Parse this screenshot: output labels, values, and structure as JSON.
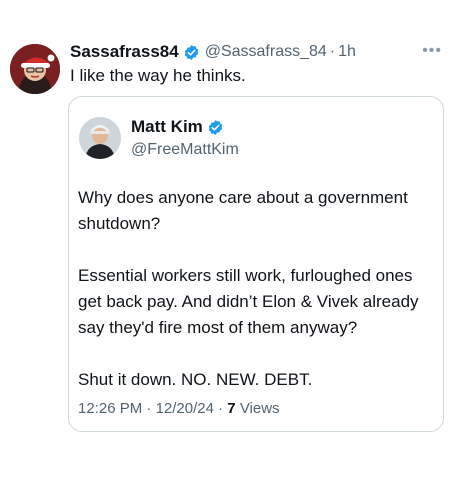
{
  "retweet": {
    "display_name": "Sassafrass84",
    "handle": "@Sassafrass_84",
    "separator": "·",
    "time": "1h",
    "text": "I like the way he thinks.",
    "more_icon": "more-horizontal-icon"
  },
  "quoted": {
    "display_name": "Matt Kim",
    "handle": "@FreeMattKim",
    "paragraphs": [
      "Why does anyone care about a government shutdown?",
      "Essential workers still work, furloughed ones get back pay. And didn’t Elon & Vivek already say they'd fire most of them anyway?",
      "Shut it down. NO. NEW. DEBT."
    ],
    "time": "12:26 PM",
    "date": "12/20/24",
    "separator": "·",
    "views_count": "7",
    "views_label": "Views"
  },
  "colors": {
    "verified": "#1d9bf0",
    "secondary_text": "#536471",
    "border": "#cfd9de"
  }
}
